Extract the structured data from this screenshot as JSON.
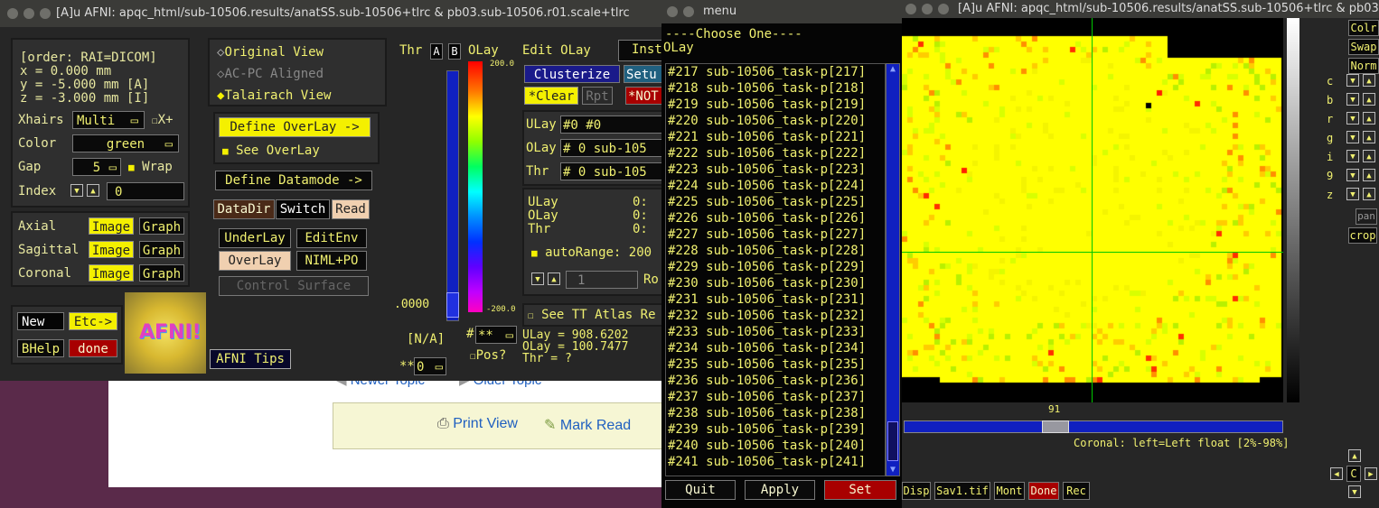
{
  "bg_forum": {
    "newer_topic": "Newer Topic",
    "older_topic": "Older Topic",
    "print_view": "Print View",
    "mark_read": "Mark Read"
  },
  "main_window": {
    "title": "[A]u AFNI: apqc_html/sub-10506.results/anatSS.sub-10506+tlrc & pb03.sub-10506.r01.scale+tlrc",
    "coords": {
      "order": "[order: RAI=DICOM]",
      "x": "x =     0.000 mm",
      "y": "y =    -5.000 mm [A]",
      "z": "z =    -3.000 mm [I]"
    },
    "xhairs_label": "Xhairs",
    "xhairs_value": "Multi",
    "xplus": "X+",
    "color_label": "Color",
    "color_value": "green",
    "gap_label": "Gap",
    "gap_value": "5",
    "wrap": "Wrap",
    "index_label": "Index",
    "index_value": "0",
    "views": [
      {
        "name": "Axial",
        "image": "Image",
        "graph": "Graph"
      },
      {
        "name": "Sagittal",
        "image": "Image",
        "graph": "Graph"
      },
      {
        "name": "Coronal",
        "image": "Image",
        "graph": "Graph"
      }
    ],
    "new": "New",
    "etc": "Etc->",
    "bhelp": "BHelp",
    "done": "done",
    "logo": "AFNI!",
    "tips": "AFNI Tips",
    "original_view": "Original View",
    "acpc": "AC-PC Aligned",
    "talairach": "Talairach View",
    "define_overlay": "Define OverLay ->",
    "see_overlay": "See OverLay",
    "define_datamode": "Define Datamode ->",
    "datadir": "DataDir",
    "switch": "Switch",
    "read": "Read",
    "underlay": "UnderLay",
    "editenv": "EditEnv",
    "overlay": "OverLay",
    "niml": "NIML+PO",
    "control_surface": "Control Surface"
  },
  "overlay_panel": {
    "thr": "Thr",
    "a": "A",
    "b": "B",
    "olay": "OLay",
    "edit_olay": "Edit OLay",
    "inst": "Inst",
    "top_val": "200.0",
    "bot_val": "-200.0",
    "thr_val": ".0000",
    "na": "[N/A]",
    "hash": "#",
    "stars": "**",
    "stars0": "**",
    "zero": "0",
    "pos": "Pos?",
    "clusterize": "Clusterize",
    "setup": "Setu",
    "clear": "*Clear",
    "rpt": "Rpt",
    "not": "*NOT",
    "ulay_label": "ULay",
    "ulay_value": "#0 #0",
    "olay_label": "OLay",
    "olay_value": "#  0 sub-105",
    "thr_label": "Thr",
    "thr_value": "#  0 sub-105",
    "stat_ulay": "ULay",
    "stat_olay": "OLay",
    "stat_thr": "Thr",
    "stat_ulay_v": "0:",
    "stat_olay_v": "0:",
    "stat_thr_v": "0:",
    "autorange": "autoRange: 200",
    "one": "1",
    "rota": "Ro",
    "see_tt": "See TT Atlas Re",
    "ulay_val": "ULay = 908.6202",
    "olay_val": "OLay = 100.7477",
    "thr_q": "Thr  = ?"
  },
  "menu_window": {
    "title": "menu",
    "header": "----Choose One----",
    "subheader": "OLay",
    "items": [
      "#217 sub-10506_task-p[217]",
      "#218 sub-10506_task-p[218]",
      "#219 sub-10506_task-p[219]",
      "#220 sub-10506_task-p[220]",
      "#221 sub-10506_task-p[221]",
      "#222 sub-10506_task-p[222]",
      "#223 sub-10506_task-p[223]",
      "#224 sub-10506_task-p[224]",
      "#225 sub-10506_task-p[225]",
      "#226 sub-10506_task-p[226]",
      "#227 sub-10506_task-p[227]",
      "#228 sub-10506_task-p[228]",
      "#229 sub-10506_task-p[229]",
      "#230 sub-10506_task-p[230]",
      "#231 sub-10506_task-p[231]",
      "#232 sub-10506_task-p[232]",
      "#233 sub-10506_task-p[233]",
      "#234 sub-10506_task-p[234]",
      "#235 sub-10506_task-p[235]",
      "#236 sub-10506_task-p[236]",
      "#237 sub-10506_task-p[237]",
      "#238 sub-10506_task-p[238]",
      "#239 sub-10506_task-p[239]",
      "#240 sub-10506_task-p[240]",
      "#241 sub-10506_task-p[241]"
    ],
    "quit": "Quit",
    "apply": "Apply",
    "set": "Set"
  },
  "image_window": {
    "title": "[A]u AFNI: apqc_html/sub-10506.results/anatSS.sub-10506+tlrc & pb03.",
    "slice_num": "91",
    "slider_fraction": 0.39,
    "status": "Coronal: left=Left float [2%-98%]",
    "side_buttons": [
      "Colr",
      "Swap",
      "Norm"
    ],
    "side_labels": [
      "c",
      "b",
      "r",
      "g",
      "i",
      "9",
      "z"
    ],
    "pan": "pan",
    "crop": "crop",
    "bottom": [
      "Disp",
      "Sav1.tif",
      "Mont",
      "Done",
      "Rec"
    ],
    "nav_c": "C"
  },
  "colors": {
    "accent_yellow": "#f4f000",
    "panel": "#2f2f2f",
    "done_red": "#a80000",
    "crosshair": "#00c800"
  }
}
